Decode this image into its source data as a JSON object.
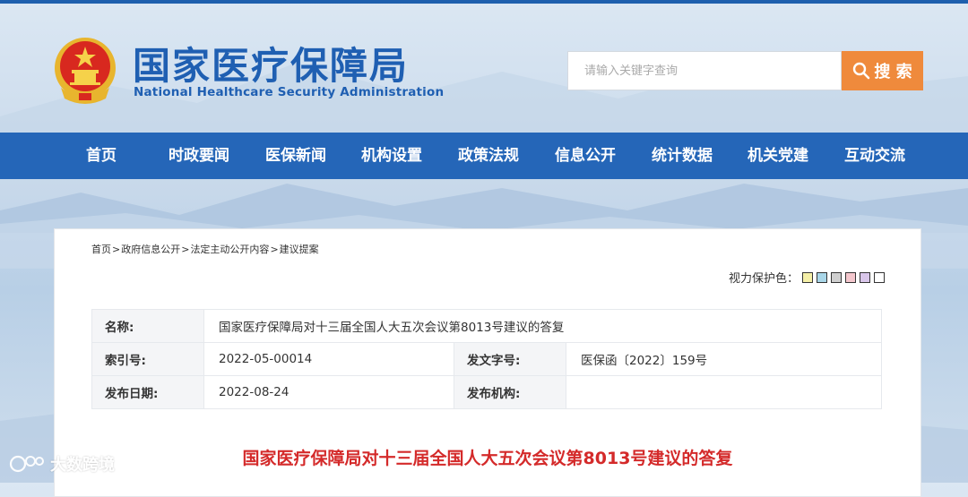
{
  "header": {
    "title_cn": "国家医疗保障局",
    "title_en": "National Healthcare Security Administration"
  },
  "search": {
    "placeholder": "请输入关键字查询",
    "button_label": "搜 索"
  },
  "nav": {
    "items": [
      {
        "label": "首页"
      },
      {
        "label": "时政要闻"
      },
      {
        "label": "医保新闻"
      },
      {
        "label": "机构设置"
      },
      {
        "label": "政策法规"
      },
      {
        "label": "信息公开"
      },
      {
        "label": "统计数据"
      },
      {
        "label": "机关党建"
      },
      {
        "label": "互动交流"
      }
    ]
  },
  "breadcrumb": {
    "items": [
      "首页",
      "政府信息公开",
      "法定主动公开内容",
      "建议提案"
    ],
    "separator": ">"
  },
  "eye_care": {
    "label": "视力保护色：",
    "swatches": [
      "#f5f0a8",
      "#a9d6e8",
      "#cfcfcf",
      "#f4c7cd",
      "#d9c6ea",
      "#ffffff"
    ]
  },
  "meta": {
    "name_label": "名称:",
    "name_value": "国家医疗保障局对十三届全国人大五次会议第8013号建议的答复",
    "index_label": "索引号:",
    "index_value": "2022-05-00014",
    "doc_no_label": "发文字号:",
    "doc_no_value": "医保函〔2022〕159号",
    "date_label": "发布日期:",
    "date_value": "2022-08-24",
    "org_label": "发布机构:",
    "org_value": ""
  },
  "article": {
    "title": "国家医疗保障局对十三届全国人大五次会议第8013号建议的答复"
  },
  "watermark": {
    "text": "大数跨境"
  },
  "colors": {
    "brand_blue": "#1f5fb2",
    "nav_blue": "#2566b8",
    "search_orange": "#ef8a3c",
    "title_red": "#d42a2a"
  }
}
